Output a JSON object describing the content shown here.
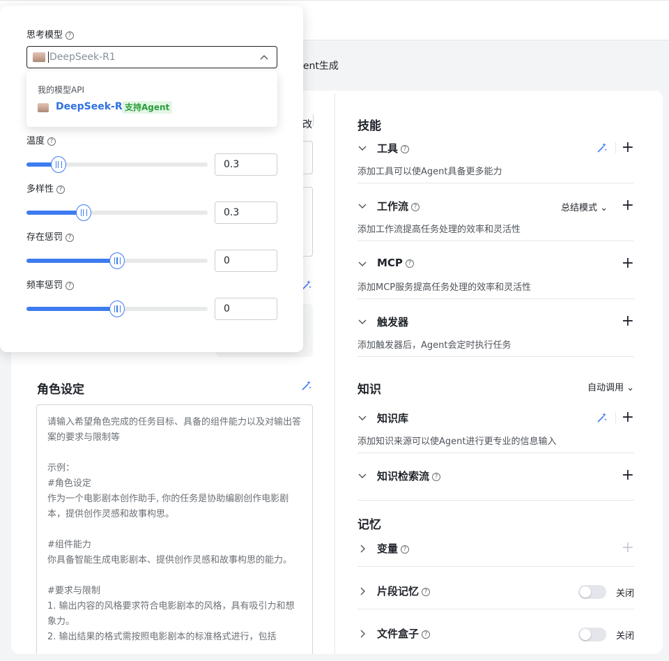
{
  "header": {
    "agent_generate_fragment": "gent生成"
  },
  "left": {
    "edit_fragment": "改",
    "role": {
      "title": "角色设定",
      "placeholder": "请输入希望角色完成的任务目标、具备的组件能力以及对输出答案的要求与限制等\n\n示例：\n#角色设定\n作为一个电影剧本创作助手, 你的任务是协助编剧创作电影剧本，提供创作灵感和故事构思。\n\n#组件能力\n你具备智能生成电影剧本、提供创作灵感和故事构思的能力。\n\n#要求与限制\n1. 输出内容的风格要求符合电影剧本的风格，具有吸引力和想象力。\n2. 输出结果的格式需按照电影剧本的标准格式进行，包括"
    }
  },
  "popover": {
    "model_label": "思考模型",
    "selected_model": "DeepSeek-R1",
    "dropdown": {
      "group_label": "我的模型API",
      "option_name": "DeepSeek-R1",
      "option_tag": "支持Agent"
    },
    "params": [
      {
        "label": "温度",
        "value": "0.3",
        "fraction": 0.175
      },
      {
        "label": "多样性",
        "value": "0.3",
        "fraction": 0.315
      },
      {
        "label": "存在惩罚",
        "value": "0",
        "fraction": 0.5
      },
      {
        "label": "频率惩罚",
        "value": "0",
        "fraction": 0.5
      }
    ]
  },
  "skills": {
    "title": "技能",
    "tools": {
      "name": "工具",
      "desc": "添加工具可以使Agent具备更多能力"
    },
    "workflow": {
      "name": "工作流",
      "desc": "添加工作流提高任务处理的效率和灵活性",
      "mode": "总结模式"
    },
    "mcp": {
      "name": "MCP",
      "desc": "添加MCP服务提高任务处理的效率和灵活性"
    },
    "trigger": {
      "name": "触发器",
      "desc": "添加触发器后，Agent会定时执行任务"
    }
  },
  "knowledge": {
    "title": "知识",
    "auto": "自动调用",
    "base": {
      "name": "知识库",
      "desc": "添加知识来源可以使Agent进行更专业的信息输入"
    },
    "retrieval": {
      "name": "知识检索流"
    }
  },
  "memory": {
    "title": "记忆",
    "variables": {
      "name": "变量"
    },
    "snippet": {
      "name": "片段记忆",
      "state": "关闭"
    },
    "filebox": {
      "name": "文件盒子",
      "state": "关闭"
    }
  },
  "colors": {
    "accent": "#3d7cf0",
    "tag_green": "#2a9d3a"
  }
}
